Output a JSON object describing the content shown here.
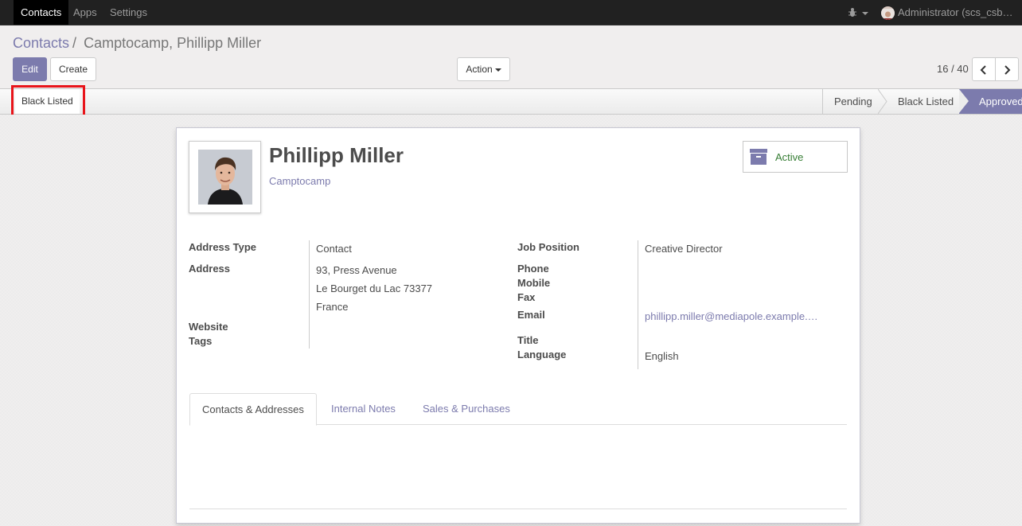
{
  "navbar": {
    "items": [
      "Contacts",
      "Apps",
      "Settings"
    ],
    "user_label": "Administrator (scs_csb…"
  },
  "breadcrumb": {
    "parent": "Contacts",
    "separator": "/",
    "current": "Camptocamp, Phillipp Miller"
  },
  "toolbar": {
    "edit_label": "Edit",
    "create_label": "Create",
    "action_label": "Action",
    "pager": "16 / 40"
  },
  "statusbar": {
    "black_listed_button": "Black Listed",
    "stages": [
      "Pending",
      "Black Listed",
      "Approved"
    ],
    "current_stage": "Approved"
  },
  "record": {
    "name": "Phillipp Miller",
    "company": "Camptocamp",
    "active_label": "Active",
    "left_fields": {
      "address_type_label": "Address Type",
      "address_type": "Contact",
      "address_label": "Address",
      "address_line1": "93, Press Avenue",
      "address_line2": "Le Bourget du Lac 73377",
      "address_line3": "France",
      "website_label": "Website",
      "tags_label": "Tags"
    },
    "right_fields": {
      "job_position_label": "Job Position",
      "job_position": "Creative Director",
      "phone_label": "Phone",
      "mobile_label": "Mobile",
      "fax_label": "Fax",
      "email_label": "Email",
      "email": "phillipp.miller@mediapole.example.…",
      "title_label": "Title",
      "language_label": "Language",
      "language": "English"
    }
  },
  "tabs": [
    "Contacts & Addresses",
    "Internal Notes",
    "Sales & Purchases"
  ],
  "colors": {
    "navbar": "#212121",
    "accent": "#7c7bad",
    "active_status": "#367d34",
    "highlight": "#e8141a"
  }
}
